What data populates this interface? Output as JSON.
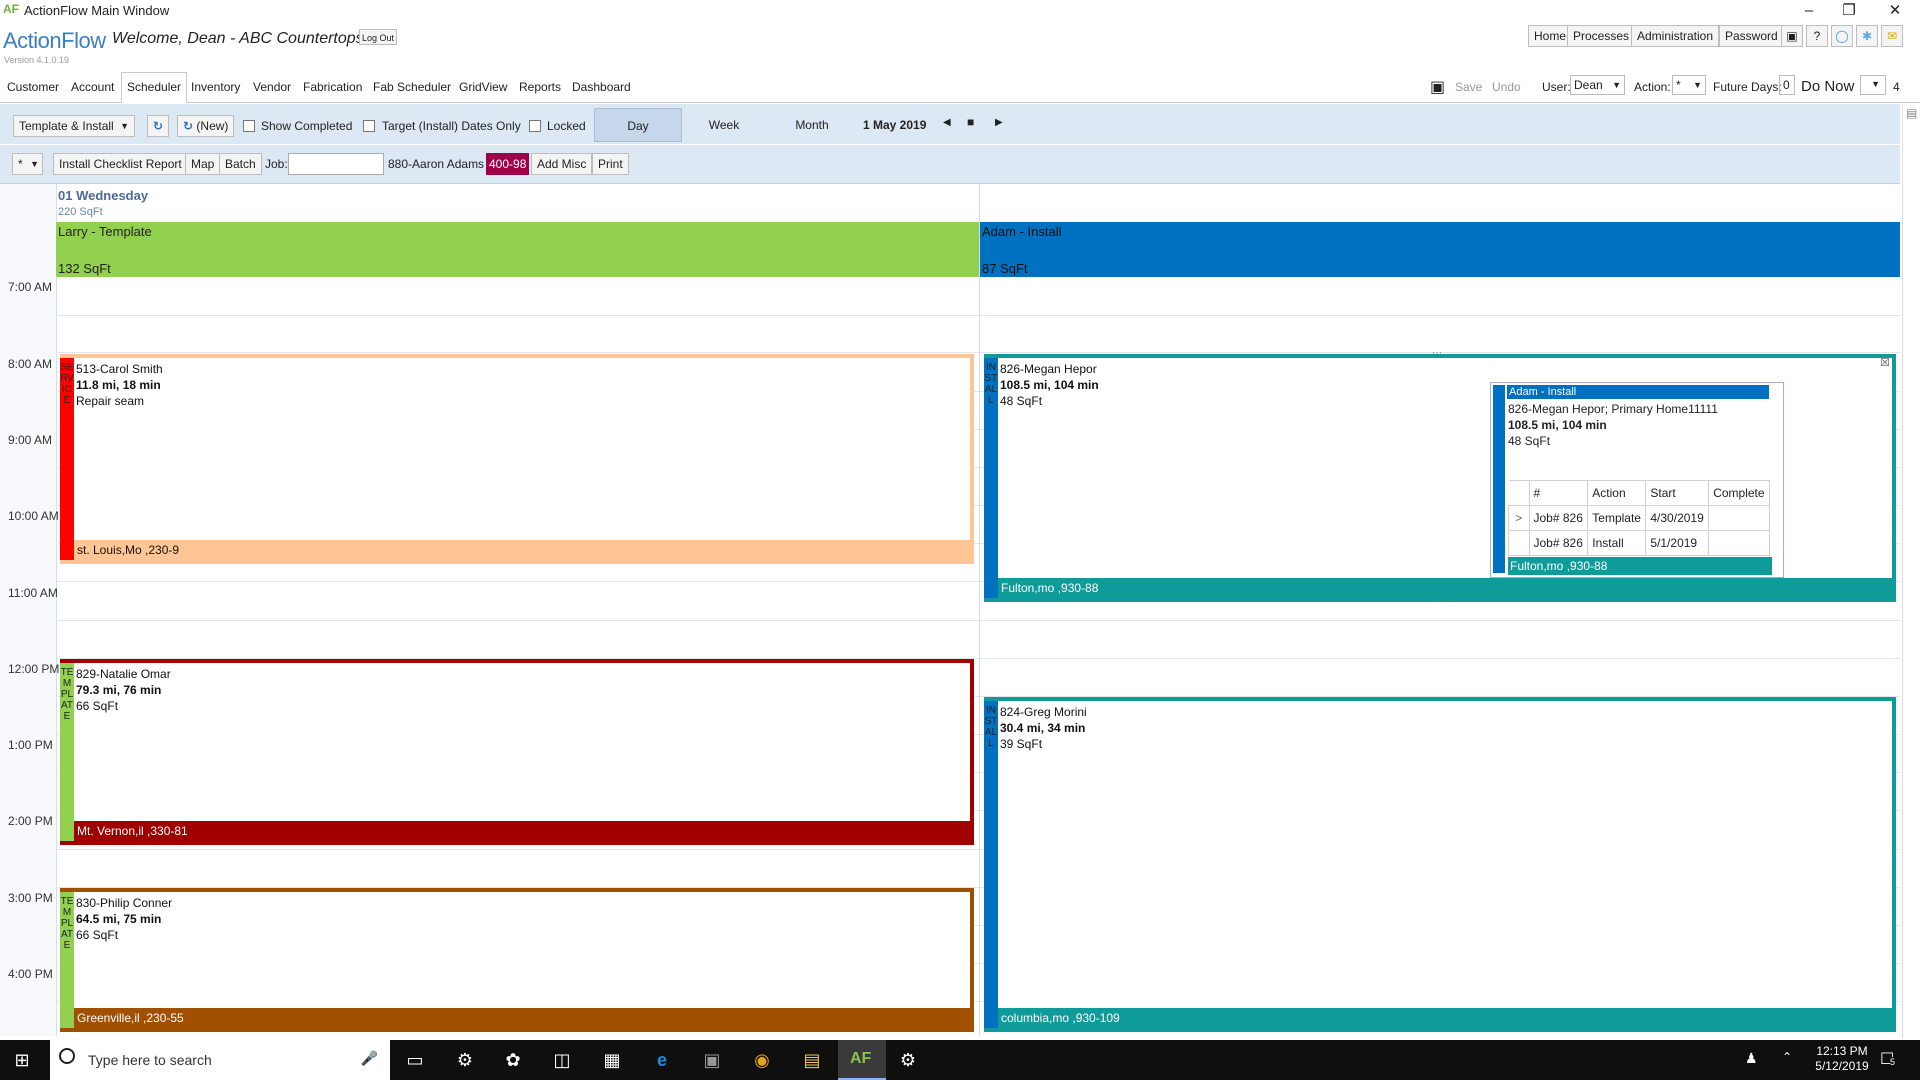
{
  "window": {
    "title": "ActionFlow Main Window",
    "app_icon": "AF"
  },
  "header": {
    "logo": "ActionFlow",
    "version": "Version 4.1.0.19",
    "welcome": "Welcome, Dean - ABC Countertops",
    "logout": "Log Out",
    "nav": [
      "Home",
      "Processes",
      "Administration",
      "Password"
    ]
  },
  "menu": {
    "items": [
      "Customer",
      "Account",
      "Scheduler",
      "Inventory",
      "Vendor",
      "Fabrication",
      "Fab Scheduler",
      "GridView",
      "Reports",
      "Dashboard"
    ],
    "active": "Scheduler",
    "save": "Save",
    "undo": "Undo",
    "user_label": "User:",
    "user_value": "Dean",
    "action_label": "Action:",
    "action_value": "*",
    "future_days_label": "Future Days:",
    "future_days_value": "0",
    "do_now": "Do Now",
    "do_now_count": "4"
  },
  "toolbar1": {
    "view_select": "Template & Install",
    "new_label": "(New)",
    "show_completed": "Show Completed",
    "target_only": "Target (Install) Dates Only",
    "locked": "Locked",
    "views": [
      "Day",
      "Week",
      "Month"
    ],
    "active_view": "Day",
    "date": "1 May 2019"
  },
  "toolbar2": {
    "filter_select": "*",
    "install_checklist": "Install Checklist Report",
    "map": "Map",
    "batch": "Batch",
    "job_label": "Job:",
    "job_value": "",
    "job_info": "880-Aaron Adams",
    "job_badge": "400-98",
    "add_misc": "Add Misc",
    "print": "Print"
  },
  "calendar": {
    "day_title": "01 Wednesday",
    "day_sqft": "220 SqFt",
    "times": [
      "7:00 AM",
      "8:00 AM",
      "9:00 AM",
      "10:00 AM",
      "11:00 AM",
      "12:00 PM",
      "1:00 PM",
      "2:00 PM",
      "3:00 PM",
      "4:00 PM"
    ],
    "resources": [
      {
        "name": "Larry - Template",
        "sqft": "132 SqFt",
        "color": "#92d050"
      },
      {
        "name": "Adam - Install",
        "sqft": "87 SqFt",
        "color": "#0070c0"
      }
    ],
    "appointments": [
      {
        "id": "a1",
        "stripe_text": "SERVICE",
        "name": "513-Carol Smith",
        "dist": "11.8 mi, 18 min",
        "extra": "Repair seam",
        "footer": "st. Louis,Mo ,230-9",
        "stripe_color": "#ff0000",
        "border_color": "#ffc595"
      },
      {
        "id": "a2",
        "stripe_text": "INSTALL",
        "name": "826-Megan Hepor",
        "dist": "108.5 mi, 104 min",
        "extra": "48 SqFt",
        "footer": "Fulton,mo ,930-88",
        "stripe_color": "#0070c0",
        "border_color": "#109b9b"
      },
      {
        "id": "a3",
        "stripe_text": "TEMPLATE",
        "name": "829-Natalie Omar",
        "dist": "79.3 mi, 76 min",
        "extra": "66 SqFt",
        "footer": "Mt. Vernon,il ,330-81",
        "stripe_color": "#92d050",
        "border_color": "#a00000"
      },
      {
        "id": "a4",
        "stripe_text": "INSTALL",
        "name": "824-Greg Morini",
        "dist": "30.4 mi, 34 min",
        "extra": "39 SqFt",
        "footer": "columbia,mo ,930-109",
        "stripe_color": "#0070c0",
        "border_color": "#109b9b"
      },
      {
        "id": "a5",
        "stripe_text": "TEMPLATE",
        "name": "830-Philip Conner",
        "dist": "64.5 mi, 75 min",
        "extra": "66 SqFt",
        "footer": "Greenville,il ,230-55",
        "stripe_color": "#92d050",
        "border_color": "#a05000"
      }
    ]
  },
  "popup": {
    "title": "Adam - Install",
    "line1": "826-Megan Hepor; Primary Home11111",
    "line2": "108.5 mi, 104 min",
    "line3": "48 SqFt",
    "columns": [
      "#",
      "Action",
      "Start",
      "Complete"
    ],
    "rows": [
      {
        "job": "Job# 826",
        "action": "Template",
        "start": "4/30/2019",
        "complete": ""
      },
      {
        "job": "Job# 826",
        "action": "Install",
        "start": "5/1/2019",
        "complete": ""
      }
    ],
    "footer": "Fulton,mo ,930-88"
  },
  "taskbar": {
    "search_placeholder": "Type here to search",
    "time": "12:13 PM",
    "date": "5/12/2019",
    "notification_count": "5"
  }
}
